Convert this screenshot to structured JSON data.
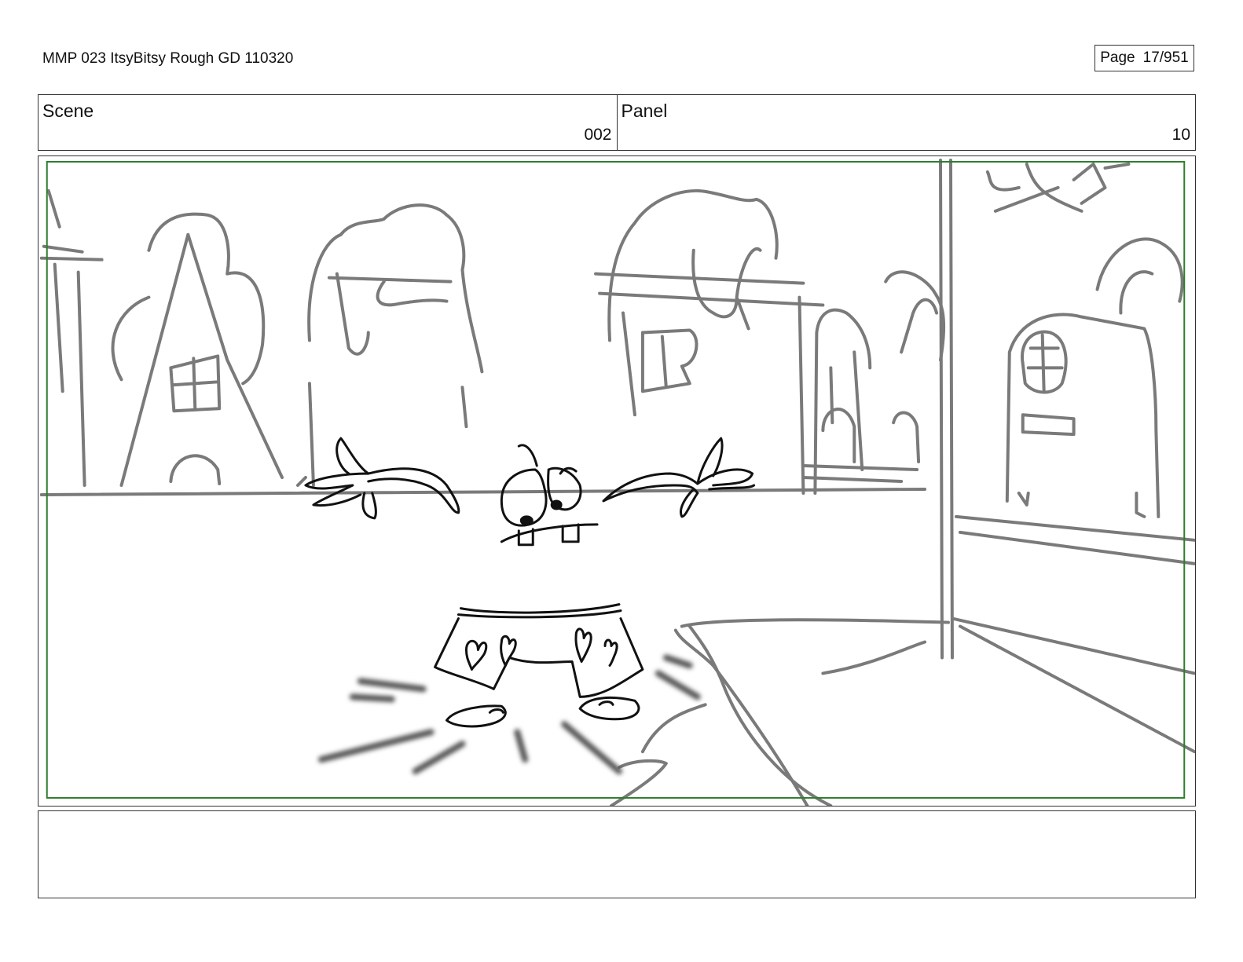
{
  "document": {
    "title": "MMP 023 ItsyBitsy Rough GD 110320"
  },
  "page": {
    "label": "Page",
    "number": "17/951"
  },
  "scene": {
    "label": "Scene",
    "value": "002"
  },
  "panel": {
    "label": "Panel",
    "value": "10"
  },
  "notes": {
    "text": ""
  },
  "colors": {
    "safe_frame": "#2e7d2e",
    "background_sketch": "#7a7a7a",
    "character_ink": "#111111"
  }
}
